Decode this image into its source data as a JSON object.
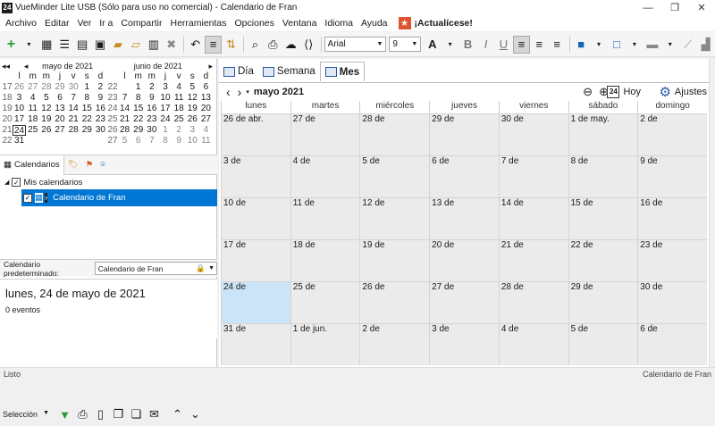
{
  "window": {
    "title": "VueMinder Lite USB (Sólo para uso no comercial) - Calendario de Fran",
    "icon_text": "24"
  },
  "menu": [
    "Archivo",
    "Editar",
    "Ver",
    "Ir a",
    "Compartir",
    "Herramientas",
    "Opciones",
    "Ventana",
    "Idioma",
    "Ayuda"
  ],
  "update_label": "¡Actualícese!",
  "toolbar": {
    "font": "Arial",
    "size": "9",
    "bold": "B",
    "italic": "I",
    "underline": "U",
    "font_size_label": "A"
  },
  "mini_cal_may": {
    "title": "mayo de 2021",
    "dow": [
      "l",
      "m",
      "m",
      "j",
      "v",
      "s",
      "d"
    ],
    "weeks": [
      {
        "wk": "17",
        "days": [
          "26",
          "27",
          "28",
          "29",
          "30",
          "1",
          "2"
        ]
      },
      {
        "wk": "18",
        "days": [
          "3",
          "4",
          "5",
          "6",
          "7",
          "8",
          "9"
        ]
      },
      {
        "wk": "19",
        "days": [
          "10",
          "11",
          "12",
          "13",
          "14",
          "15",
          "16"
        ]
      },
      {
        "wk": "20",
        "days": [
          "17",
          "18",
          "19",
          "20",
          "21",
          "22",
          "23"
        ]
      },
      {
        "wk": "21",
        "days": [
          "24",
          "25",
          "26",
          "27",
          "28",
          "29",
          "30"
        ]
      },
      {
        "wk": "22",
        "days": [
          "31",
          "",
          "",
          "",
          "",
          "",
          ""
        ]
      }
    ]
  },
  "mini_cal_jun": {
    "title": "junio de 2021",
    "dow": [
      "l",
      "m",
      "m",
      "j",
      "v",
      "s",
      "d"
    ],
    "weeks": [
      {
        "wk": "22",
        "days": [
          "",
          "1",
          "2",
          "3",
          "4",
          "5",
          "6"
        ]
      },
      {
        "wk": "23",
        "days": [
          "7",
          "8",
          "9",
          "10",
          "11",
          "12",
          "13"
        ]
      },
      {
        "wk": "24",
        "days": [
          "14",
          "15",
          "16",
          "17",
          "18",
          "19",
          "20"
        ]
      },
      {
        "wk": "25",
        "days": [
          "21",
          "22",
          "23",
          "24",
          "25",
          "26",
          "27"
        ]
      },
      {
        "wk": "26",
        "days": [
          "28",
          "29",
          "30",
          "1",
          "2",
          "3",
          "4"
        ]
      },
      {
        "wk": "27",
        "days": [
          "5",
          "6",
          "7",
          "8",
          "9",
          "10",
          "11"
        ]
      }
    ]
  },
  "sidebar": {
    "tab_calendars": "Calendarios",
    "tree_root": "Mis calendarios",
    "tree_item": "Calendario de Fran",
    "default_label": "Calendario predeterminado:",
    "default_value": "Calendario de Fran",
    "details_date": "lunes, 24 de mayo de 2021",
    "details_count": "0 eventos",
    "selection_label": "Selección"
  },
  "views": {
    "day": "Día",
    "week": "Semana",
    "month": "Mes"
  },
  "nav": {
    "month_label": "mayo 2021",
    "today": "Hoy",
    "today_icon": "24",
    "settings": "Ajustes"
  },
  "month": {
    "dow": [
      "lunes",
      "martes",
      "miércoles",
      "jueves",
      "viernes",
      "sábado",
      "domingo"
    ],
    "weeks": [
      [
        "26 de abr.",
        "27 de",
        "28 de",
        "29 de",
        "30 de",
        "1 de may.",
        "2 de"
      ],
      [
        "3 de",
        "4 de",
        "5 de",
        "6 de",
        "7 de",
        "8 de",
        "9 de"
      ],
      [
        "10 de",
        "11 de",
        "12 de",
        "13 de",
        "14 de",
        "15 de",
        "16 de"
      ],
      [
        "17 de",
        "18 de",
        "19 de",
        "20 de",
        "21 de",
        "22 de",
        "23 de"
      ],
      [
        "24 de",
        "25 de",
        "26 de",
        "27 de",
        "28 de",
        "29 de",
        "30 de"
      ],
      [
        "31 de",
        "1 de jun.",
        "2 de",
        "3 de",
        "4 de",
        "5 de",
        "6 de"
      ]
    ]
  },
  "status": {
    "left": "Listo",
    "right": "Calendario de Fran"
  },
  "colors": {
    "accent": "#0077d4",
    "today_cell": "#cce4f7",
    "update": "#e0542d"
  }
}
